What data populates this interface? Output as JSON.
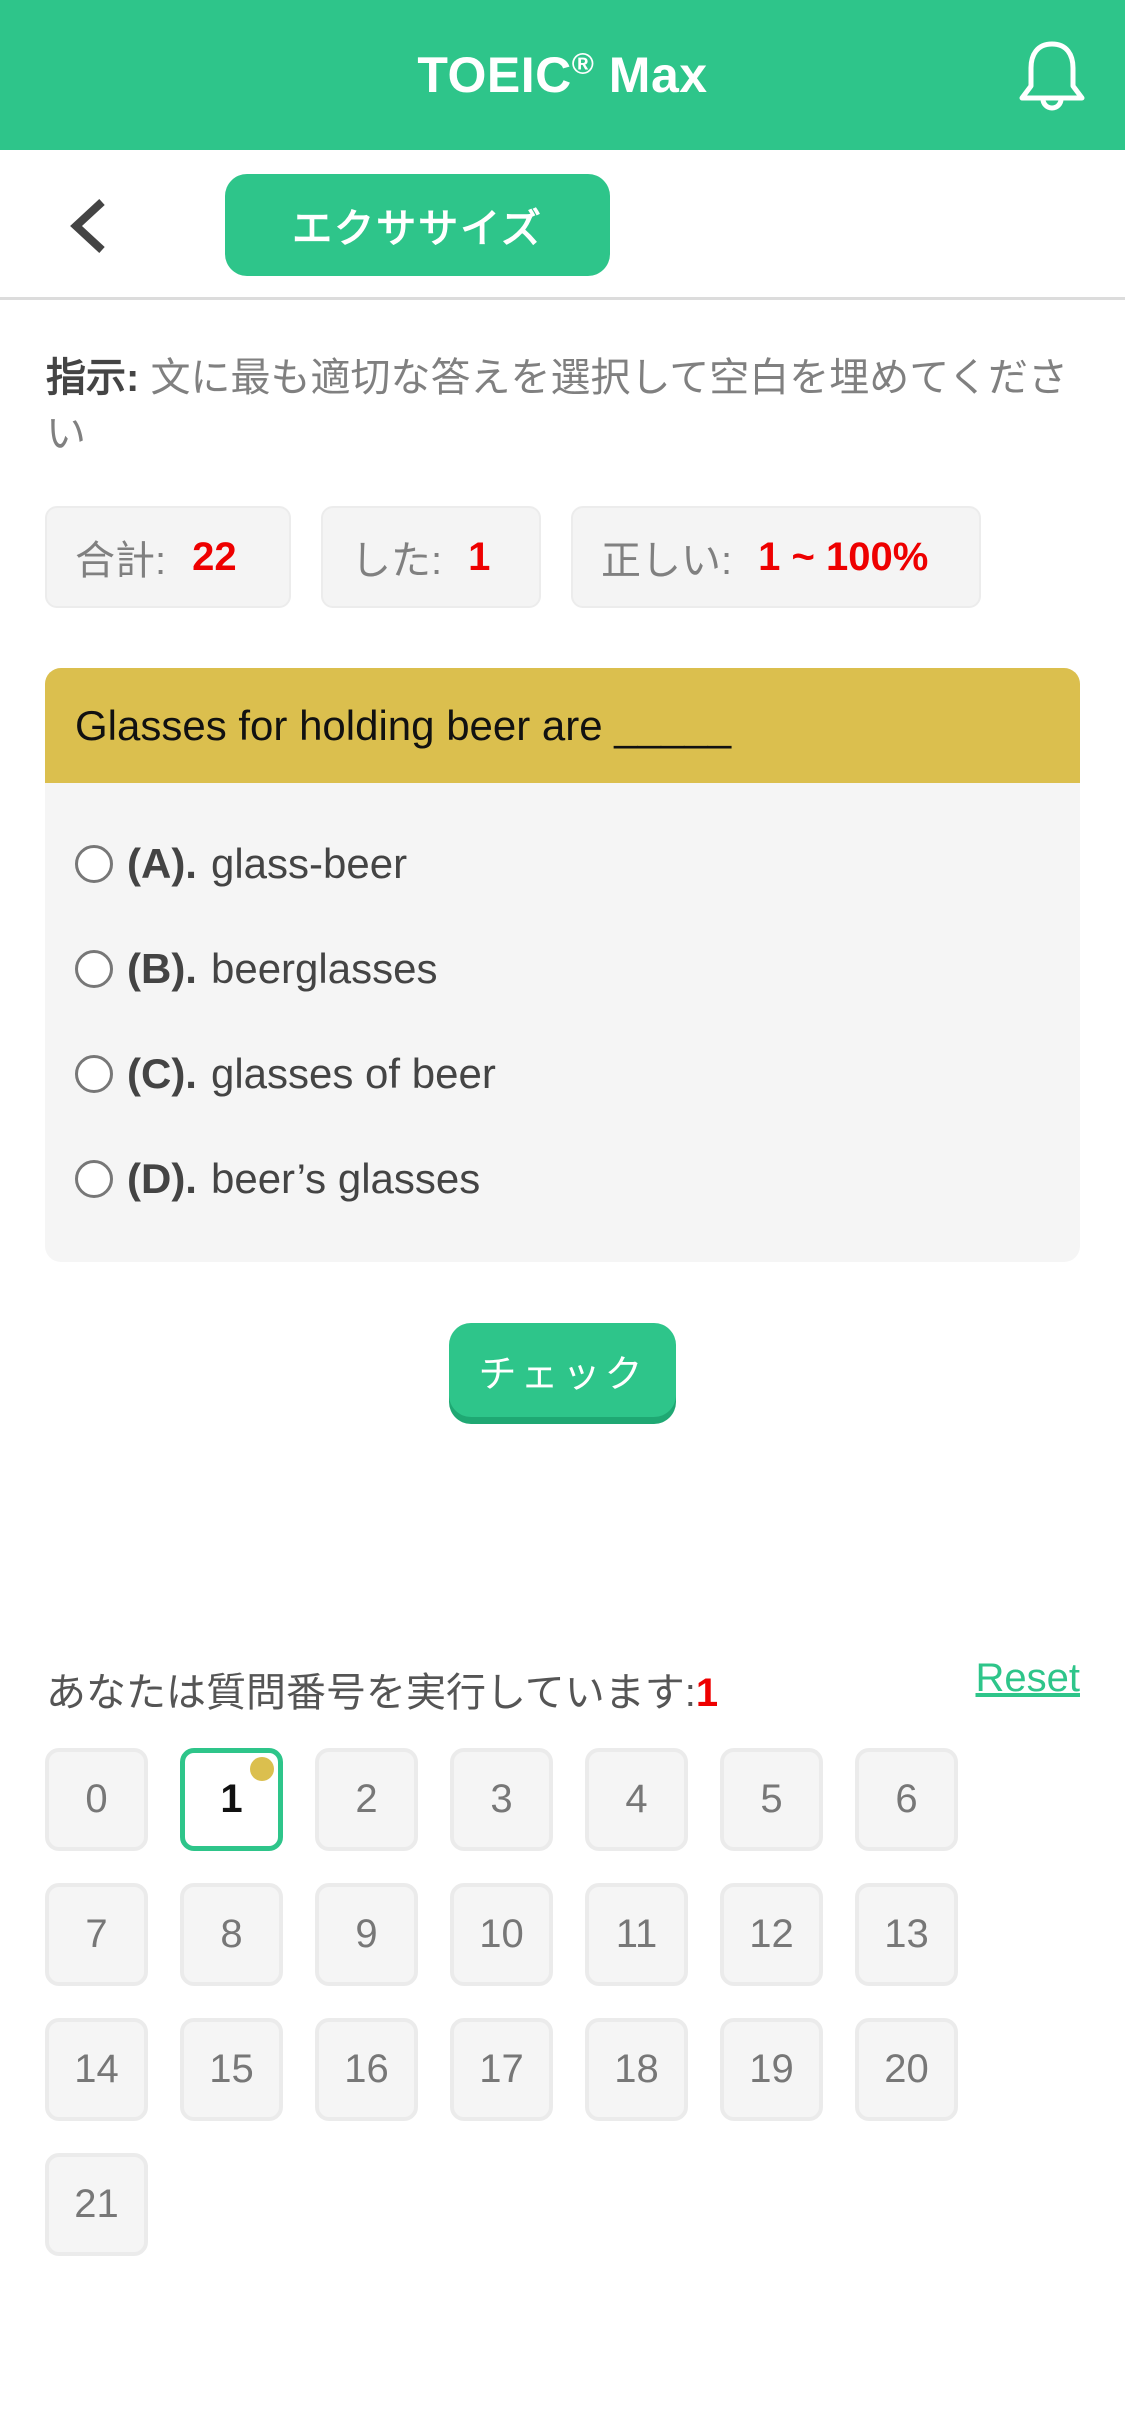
{
  "appbar": {
    "title": "TOEIC",
    "title_mark": "®",
    "title_suffix": " Max",
    "icon": "bell-icon"
  },
  "subbar": {
    "back_icon": "chevron-left-icon",
    "tab_label": "エクササイズ"
  },
  "instruction": {
    "label": "指示:",
    "text": " 文に最も適切な答えを選択して空白を埋めてください"
  },
  "stats": {
    "total_label": "合計:",
    "total_value": "22",
    "done_label": "した:",
    "done_value": "1",
    "correct_label": "正しい:",
    "correct_value": "1 ~ 100%"
  },
  "question": {
    "text": "Glasses for holding beer are _____",
    "options": [
      {
        "key": "(A).",
        "text": "glass-beer"
      },
      {
        "key": "(B).",
        "text": "beerglasses"
      },
      {
        "key": "(C).",
        "text": "glasses of beer"
      },
      {
        "key": "(D).",
        "text": "beer’s glasses"
      }
    ]
  },
  "check_label": "チェック",
  "progress": {
    "label": "あなたは質問番号を実行しています:",
    "current": "1",
    "reset_label": "Reset"
  },
  "colors": {
    "brand": "#2ec58a",
    "question_header": "#dbbf4e",
    "accent_red": "#ee0000"
  },
  "questions": [
    "0",
    "1",
    "2",
    "3",
    "4",
    "5",
    "6",
    "7",
    "8",
    "9",
    "10",
    "11",
    "12",
    "13",
    "14",
    "15",
    "16",
    "17",
    "18",
    "19",
    "20",
    "21"
  ],
  "active_question": "1"
}
